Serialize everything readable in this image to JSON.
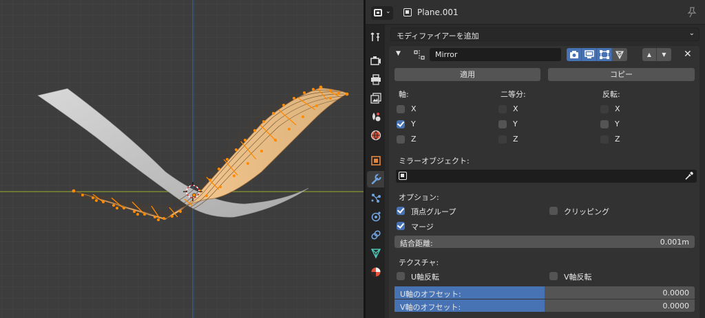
{
  "colors": {
    "accent": "#4772b3",
    "viewport_bg": "#3d3d3d",
    "mesh_gray": "#cfcfcf",
    "mesh_selected": "#e0b57c",
    "vertex_orange": "#ff8a00",
    "axis_x_line": "#8b9a2c",
    "axis_y_line": "#3b5f8a"
  },
  "header": {
    "editor_icon": "properties-editor-icon",
    "object_name": "Plane.001",
    "pin_icon": "pin-icon"
  },
  "tabs": [
    {
      "name": "tool-tab",
      "icon": "wrench-screwdriver-icon",
      "active": false
    },
    {
      "name": "render-tab",
      "icon": "camera-back-icon",
      "active": false
    },
    {
      "name": "output-tab",
      "icon": "printer-icon",
      "active": false
    },
    {
      "name": "view-layer-tab",
      "icon": "images-icon",
      "active": false
    },
    {
      "name": "scene-tab",
      "icon": "scene-icon",
      "active": false
    },
    {
      "name": "world-tab",
      "icon": "world-icon",
      "active": false
    },
    {
      "name": "object-tab",
      "icon": "object-square-icon",
      "active": false
    },
    {
      "name": "modifier-tab",
      "icon": "wrench-icon",
      "active": true
    },
    {
      "name": "particles-tab",
      "icon": "particles-icon",
      "active": false
    },
    {
      "name": "physics-tab",
      "icon": "physics-icon",
      "active": false
    },
    {
      "name": "constraints-tab",
      "icon": "constraint-icon",
      "active": false
    },
    {
      "name": "data-tab",
      "icon": "mesh-data-icon",
      "active": false
    },
    {
      "name": "material-tab",
      "icon": "material-icon",
      "active": false
    }
  ],
  "add_modifier": {
    "label": "モディファイアーを追加"
  },
  "modifier": {
    "name": "Mirror",
    "apply_label": "適用",
    "copy_label": "コピー",
    "axis_heading": "軸:",
    "bisect_heading": "二等分:",
    "flip_heading": "反転:",
    "axes": [
      {
        "label": "X",
        "axis": false,
        "bisect": false,
        "flip": false
      },
      {
        "label": "Y",
        "axis": true,
        "bisect": false,
        "flip": false
      },
      {
        "label": "Z",
        "axis": false,
        "bisect": false,
        "flip": false
      }
    ],
    "mirror_object_label": "ミラーオブジェクト:",
    "options_heading": "オプション:",
    "vertex_groups_label": "頂点グループ",
    "vertex_groups_checked": true,
    "clipping_label": "クリッピング",
    "clipping_checked": false,
    "merge_label": "マージ",
    "merge_checked": true,
    "merge_distance_label": "結合距離:",
    "merge_distance_value": "0.001m",
    "textures_heading": "テクスチャ:",
    "u_flip_label": "U軸反転",
    "u_flip_checked": false,
    "v_flip_label": "V軸反転",
    "v_flip_checked": false,
    "u_offset_label": "U軸のオフセット:",
    "u_offset_value": "0.0000",
    "v_offset_label": "V軸のオフセット:",
    "v_offset_value": "0.0000",
    "offset_fill_fraction": 0.5
  }
}
